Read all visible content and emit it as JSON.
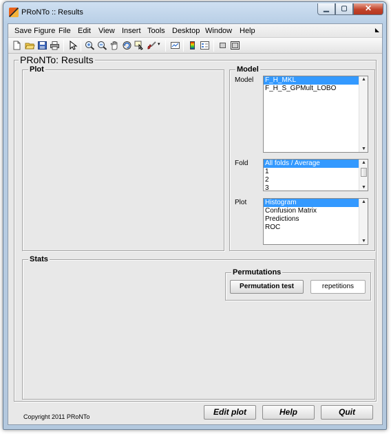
{
  "window": {
    "title": "PRoNTo :: Results"
  },
  "menubar": {
    "items": [
      "Save Figure",
      "File",
      "Edit",
      "View",
      "Insert",
      "Tools",
      "Desktop",
      "Window",
      "Help"
    ]
  },
  "toolbar": {
    "icons": [
      "new-file-icon",
      "open-folder-icon",
      "save-icon",
      "print-icon",
      "pointer-icon",
      "zoom-in-icon",
      "zoom-out-icon",
      "pan-hand-icon",
      "rotate-3d-icon",
      "data-cursor-icon",
      "brush-icon",
      "link-plot-icon",
      "colorbar-icon",
      "legend-icon",
      "hide-plot-tools-icon",
      "show-plot-tools-icon"
    ]
  },
  "results": {
    "title": "PRoNTo: Results",
    "plot_panel_title": "Plot",
    "model_panel": {
      "title": "Model",
      "model_label": "Model",
      "models": [
        "F_H_MKL",
        "F_H_S_GPMult_LOBO"
      ],
      "selected_model": "F_H_MKL",
      "fold_label": "Fold",
      "folds": [
        "All folds / Average",
        "1",
        "2",
        "3"
      ],
      "selected_fold": "All folds / Average",
      "plot_label": "Plot",
      "plots": [
        "Histogram",
        "Confusion Matrix",
        "Predictions",
        "ROC"
      ],
      "selected_plot": "Histogram"
    },
    "stats_panel": {
      "title": "Stats",
      "permutations": {
        "title": "Permutations",
        "button_label": "Permutation test",
        "repetitions_placeholder": "repetitions"
      }
    },
    "copyright": "Copyright 2011 PRoNTo",
    "buttons": {
      "edit_plot": "Edit plot",
      "help": "Help",
      "quit": "Quit"
    }
  }
}
